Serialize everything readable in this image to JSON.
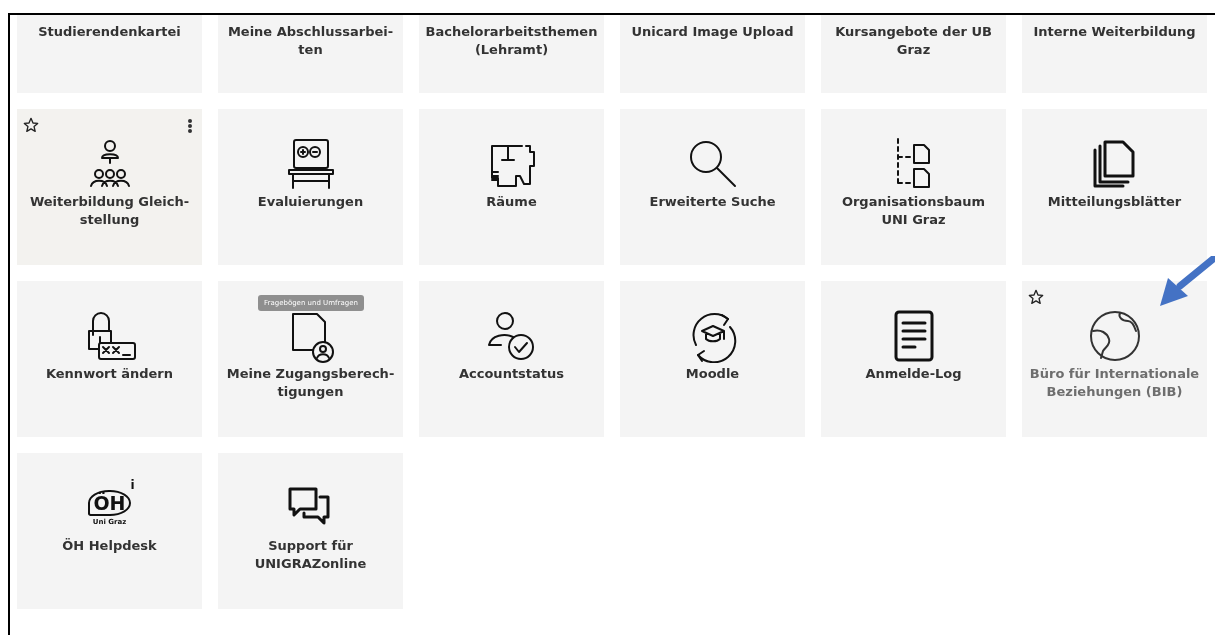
{
  "rows": [
    {
      "tiles": [
        {
          "label": "Studierendenkartei",
          "hovered": false,
          "star": false,
          "dimmed": false
        },
        {
          "label": "Meine Abschlussarbei-\nten",
          "hovered": false,
          "star": false,
          "dimmed": false
        },
        {
          "label": "Bachelorarbeitsthemen\n(Lehramt)",
          "hovered": false,
          "star": false,
          "dimmed": false
        },
        {
          "label": "Unicard Image Upload",
          "hovered": false,
          "star": false,
          "dimmed": false
        },
        {
          "label": "Kursangebote der UB\nGraz",
          "hovered": false,
          "star": false,
          "dimmed": false
        },
        {
          "label": "Interne Weiterbildung",
          "hovered": false,
          "star": false,
          "dimmed": false
        }
      ]
    },
    {
      "tiles": [
        {
          "label": "Weiterbildung Gleich-\nstellung",
          "hovered": true,
          "star": true,
          "dimmed": false
        },
        {
          "label": "Evaluierungen",
          "hovered": false,
          "star": false,
          "dimmed": false
        },
        {
          "label": "Räume",
          "hovered": false,
          "star": false,
          "dimmed": false
        },
        {
          "label": "Erweiterte Suche",
          "hovered": false,
          "star": false,
          "dimmed": false
        },
        {
          "label": "Organisationsbaum\nUNI Graz",
          "hovered": false,
          "star": false,
          "dimmed": false
        },
        {
          "label": "Mitteilungsblätter",
          "hovered": false,
          "star": false,
          "dimmed": false
        }
      ]
    },
    {
      "tiles": [
        {
          "label": "Kennwort ändern",
          "hovered": false,
          "star": false,
          "dimmed": false
        },
        {
          "label": "Meine Zugangsberech-\ntigungen",
          "hovered": false,
          "star": false,
          "dimmed": false,
          "tooltip": "Fragebögen und Umfragen"
        },
        {
          "label": "Accountstatus",
          "hovered": false,
          "star": false,
          "dimmed": false
        },
        {
          "label": "Moodle",
          "hovered": false,
          "star": false,
          "dimmed": false
        },
        {
          "label": "Anmelde-Log",
          "hovered": false,
          "star": false,
          "dimmed": false
        },
        {
          "label": "Büro für Internationale\nBeziehungen (BIB)",
          "hovered": false,
          "star": true,
          "dimmed": true
        }
      ]
    },
    {
      "tiles": [
        {
          "label": "ÖH Helpdesk",
          "hovered": false,
          "star": false,
          "dimmed": false,
          "logo": {
            "main": "ÖH",
            "superscript": "i",
            "caption": "Uni Graz"
          }
        },
        {
          "label": "Support für\nUNIGRAZonline",
          "hovered": false,
          "star": false,
          "dimmed": false
        }
      ]
    }
  ]
}
